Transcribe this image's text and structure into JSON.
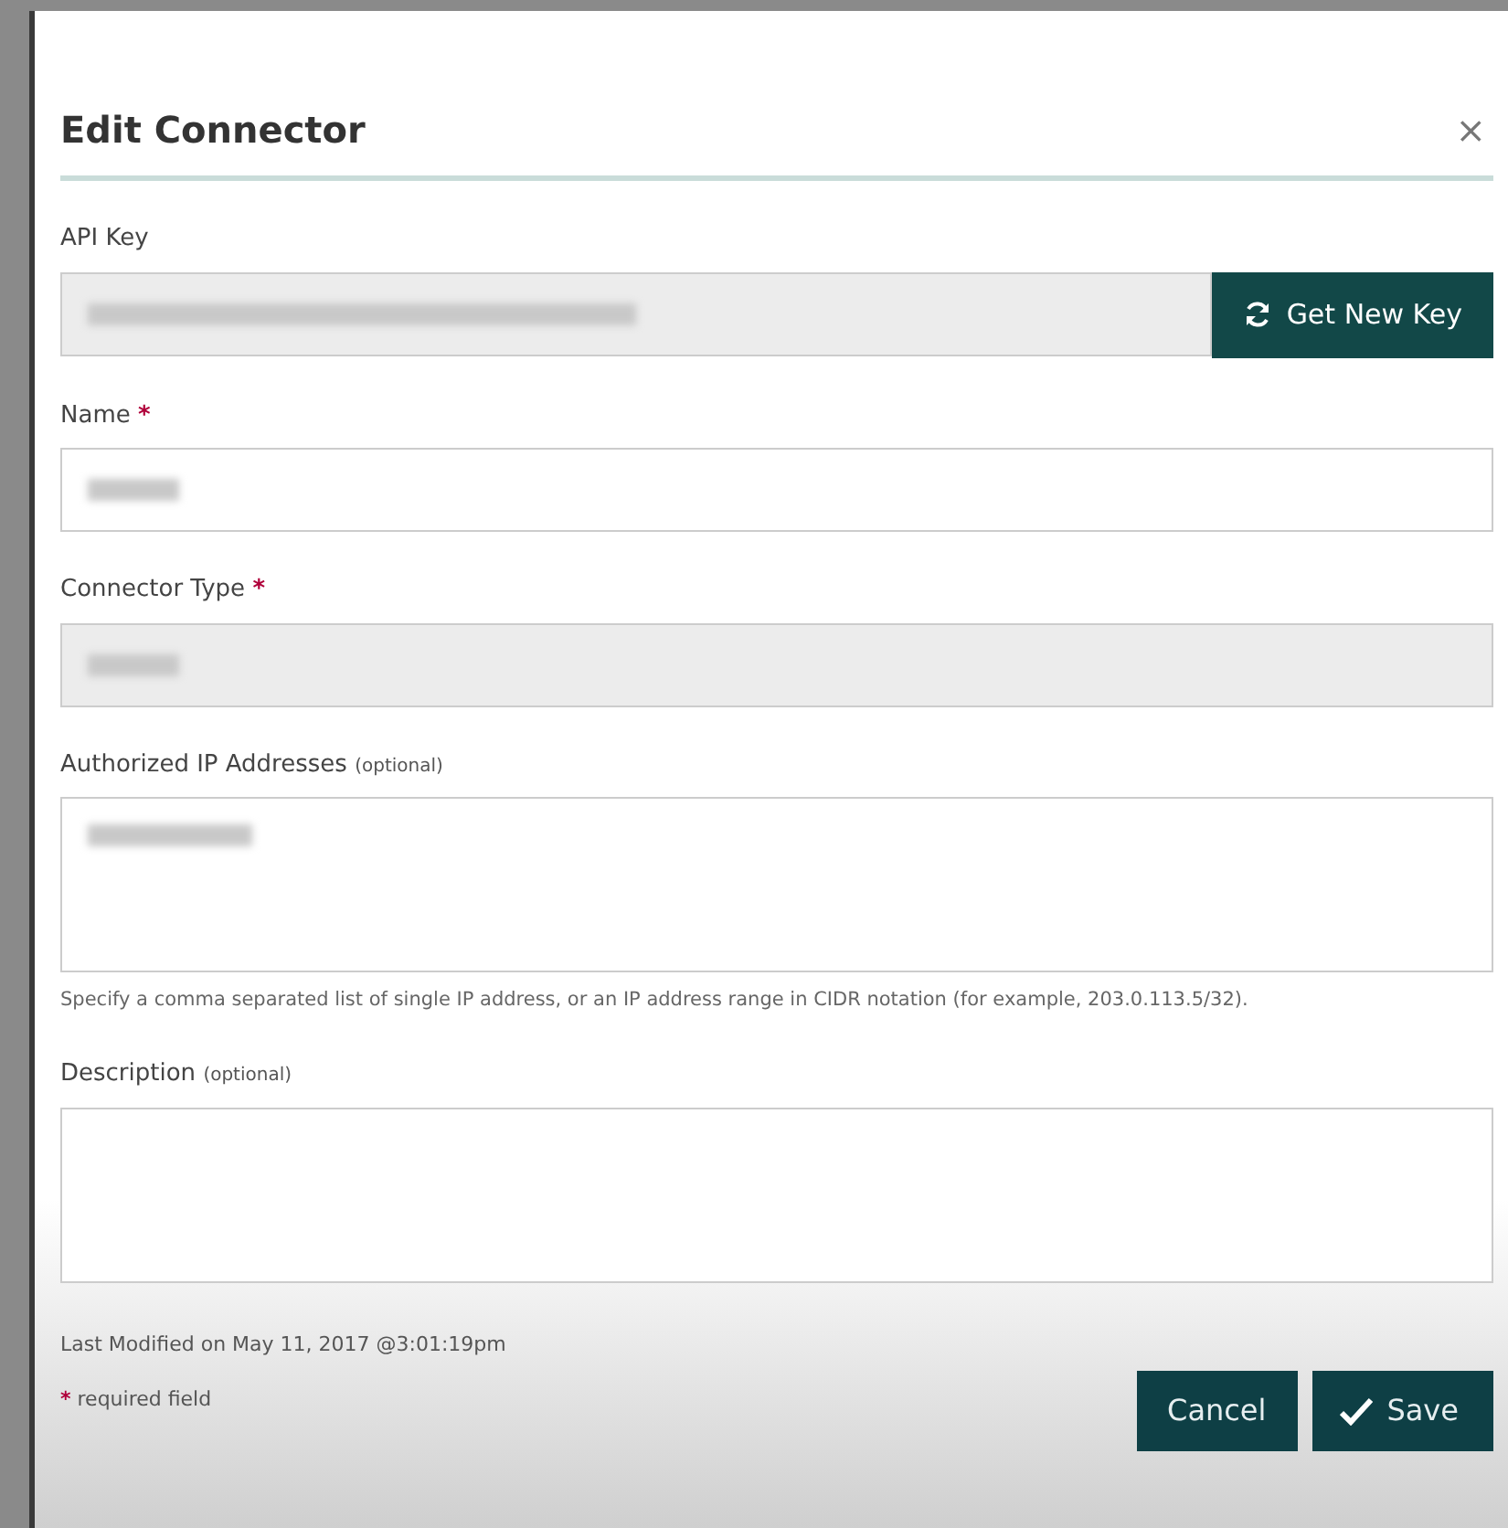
{
  "dialog": {
    "title": "Edit Connector",
    "close": "×"
  },
  "fields": [
    {
      "kind": "key",
      "label": "API Key",
      "disabled": true,
      "redacted": true,
      "button": "Get New Key"
    },
    {
      "kind": "input",
      "label": "Name",
      "required_mark": "*",
      "disabled": false,
      "redacted": true
    },
    {
      "kind": "input",
      "label": "Connector Type",
      "required_mark": "*",
      "disabled": true,
      "redacted": true
    },
    {
      "kind": "textarea",
      "label": "Authorized IP Addresses",
      "optional_note": "(optional)",
      "disabled": false,
      "redacted": true,
      "help": "Specify a comma separated list of single IP address, or an IP address range in CIDR notation (for example, 203.0.113.5/32)."
    },
    {
      "kind": "textarea",
      "label": "Description",
      "optional_note": "(optional)",
      "disabled": false
    }
  ],
  "footer": {
    "last_modified": "Last Modified on May 11, 2017 @3:01:19pm",
    "required_mark": "*",
    "required_note": "required field",
    "buttons": [
      {
        "kind": "cancel",
        "label": "Cancel"
      },
      {
        "kind": "save",
        "label": "Save"
      }
    ]
  }
}
